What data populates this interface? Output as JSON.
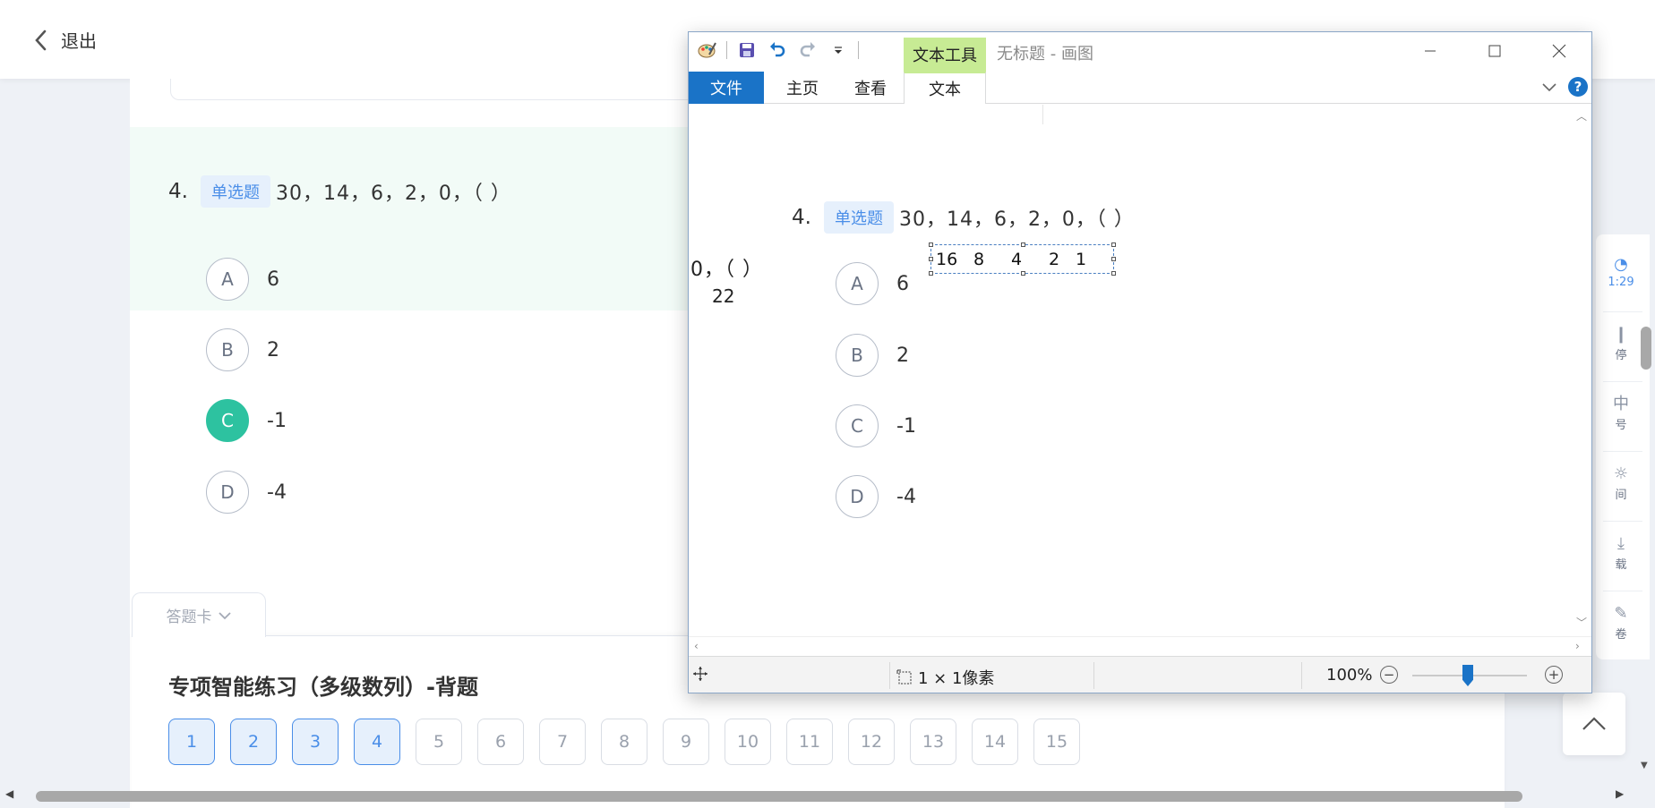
{
  "header": {
    "back_label": "退出"
  },
  "question": {
    "number": "4.",
    "type_tag": "单选题",
    "text": "30，14，6，2，0，（ ）",
    "options": [
      {
        "letter": "A",
        "text": "6",
        "selected": false
      },
      {
        "letter": "B",
        "text": "2",
        "selected": false
      },
      {
        "letter": "C",
        "text": "-1",
        "selected": true
      },
      {
        "letter": "D",
        "text": "-4",
        "selected": false
      }
    ]
  },
  "answer_sheet": {
    "tab_label": "答题卡",
    "title": "专项智能练习（多级数列）-背题",
    "numbers": [
      "1",
      "2",
      "3",
      "4",
      "5",
      "6",
      "7",
      "8",
      "9",
      "10",
      "11",
      "12",
      "13",
      "14",
      "15"
    ],
    "answered_count": 4
  },
  "side_tools": {
    "timer": "1:29",
    "items": [
      "停",
      "号",
      "间",
      "载",
      "卷"
    ]
  },
  "paint": {
    "window_title": "无标题 - 画图",
    "context_tab": "文本工具",
    "ribbon_tabs": {
      "file": "文件",
      "home": "主页",
      "view": "查看",
      "text": "文本"
    },
    "help": "?",
    "status": {
      "selection_size": "1 × 1像素",
      "zoom": "100%"
    },
    "canvas": {
      "fragment_line": "0，（ ）",
      "fragment_value": "22",
      "textbox_values": [
        "16",
        "8",
        "4",
        "2",
        "1"
      ]
    }
  },
  "colors": {
    "accent": "#4a8ee8",
    "selected": "#2dc2a0",
    "paint_blue": "#1a73c7",
    "context_green": "#c7eb94"
  }
}
